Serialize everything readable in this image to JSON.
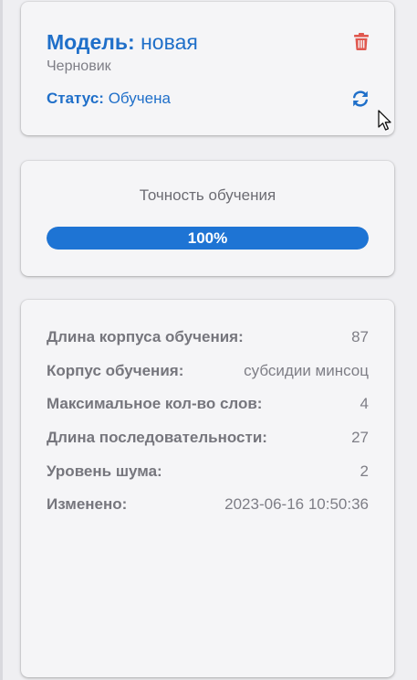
{
  "model_card": {
    "title_label": "Модель:",
    "title_value": "новая",
    "subtitle": "Черновик",
    "status_label": "Статус:",
    "status_value": "Обучена",
    "delete_icon": "trash-icon",
    "refresh_icon": "refresh-icon"
  },
  "accuracy_card": {
    "title": "Точность обучения",
    "progress_text": "100%",
    "progress_value": 1.0
  },
  "info_card": {
    "rows": [
      {
        "label": "Длина корпуса обучения:",
        "value": "87"
      },
      {
        "label": "Корпус обучения:",
        "value": "субсидии минсоц"
      },
      {
        "label": "Максимальное кол-во слов:",
        "value": "4"
      },
      {
        "label": "Длина последовательности:",
        "value": "27"
      },
      {
        "label": "Уровень шума:",
        "value": "2"
      },
      {
        "label": "Изменено:",
        "value": "2023-06-16 10:50:36"
      }
    ]
  },
  "colors": {
    "accent": "#1f6fc9",
    "progress": "#1e74d4",
    "danger": "#e0584f",
    "muted_text": "#7e7e86",
    "card_bg": "#f5f5f7"
  }
}
